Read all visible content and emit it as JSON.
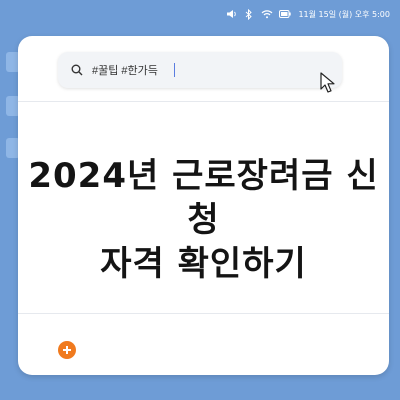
{
  "taskbar": {
    "clock": "11월 15일 (월) 오후 5:00",
    "icons": [
      "volume-icon",
      "bluetooth-icon",
      "wifi-icon",
      "battery-icon"
    ]
  },
  "search": {
    "query": "#꿀팁 #한가득"
  },
  "content": {
    "headline_line1": "2024년 근로장려금 신청",
    "headline_line2": "자격 확인하기"
  },
  "colors": {
    "background": "#6e9cd6",
    "accent": "#f07a1e"
  }
}
